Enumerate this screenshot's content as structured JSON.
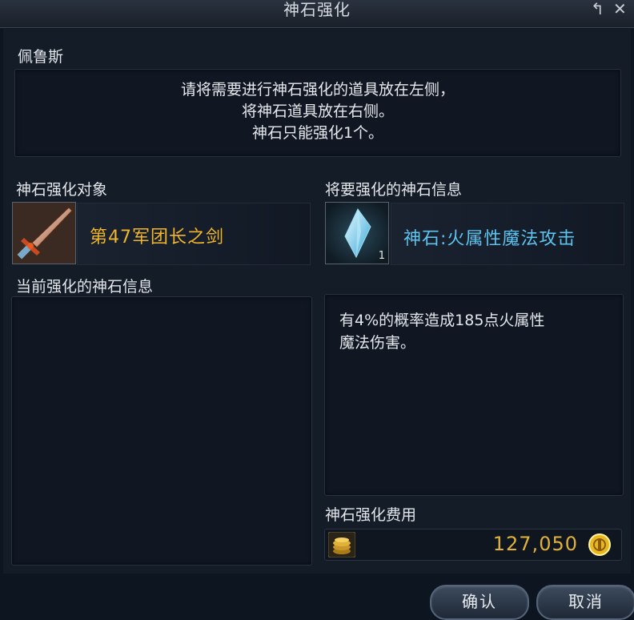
{
  "window": {
    "title": "神石强化",
    "restore_icon": "restore-icon",
    "close_icon": "close-icon"
  },
  "npc": {
    "name": "佩鲁斯"
  },
  "instructions": [
    "请将需要进行神石强化的道具放在左侧，",
    "将神石道具放在右侧。",
    "神石只能强化1个。"
  ],
  "left": {
    "target_label": "神石强化对象",
    "item_icon": "sword-icon",
    "item_name": "第47军团长之剑",
    "current_info_label": "当前强化的神石信息"
  },
  "right": {
    "info_label": "将要强化的神石信息",
    "stone_icon": "crystal-icon",
    "stone_count": "1",
    "stone_name": "神石:火属性魔法攻击",
    "description": [
      "有4%的概率造成185点火属性",
      "魔法伤害。"
    ],
    "cost_label": "神石强化费用",
    "coin_icon": "coin-stack-icon",
    "cost_value": "127,050",
    "currency_icon": "kinah-icon"
  },
  "buttons": {
    "confirm": "确认",
    "cancel": "取消"
  },
  "colors": {
    "gold": "#f0b52a",
    "blue": "#5dc3ee"
  }
}
